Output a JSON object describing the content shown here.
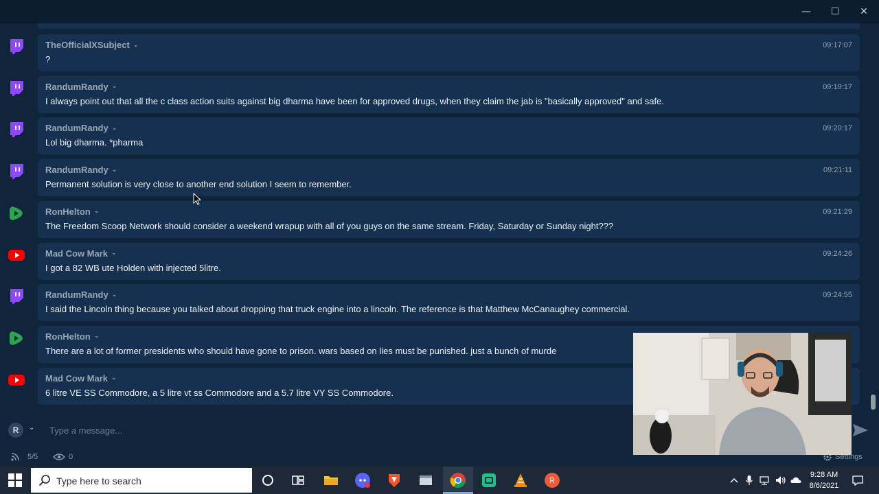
{
  "window": {
    "minimize_symbol": "—",
    "maximize_symbol": "☐",
    "close_symbol": "✕"
  },
  "messages": [
    {
      "platform": "twitch",
      "user": "TheOfficialXSubject",
      "time": "09:17:07",
      "text": "?"
    },
    {
      "platform": "twitch",
      "user": "RandumRandy",
      "time": "09:19:17",
      "text": "I always point out that all the c class action suits against big dharma have been for approved drugs, when they claim the jab is \"basically approved\" and safe."
    },
    {
      "platform": "twitch",
      "user": "RandumRandy",
      "time": "09:20:17",
      "text": "Lol big dharma. *pharma"
    },
    {
      "platform": "twitch",
      "user": "RandumRandy",
      "time": "09:21:11",
      "text": "Permanent solution is very close to another end solution I seem to remember."
    },
    {
      "platform": "rumble",
      "user": "RonHelton",
      "time": "09:21:29",
      "text": "The Freedom Scoop Network should consider a weekend wrapup with all of you guys on the same stream. Friday, Saturday or Sunday night???"
    },
    {
      "platform": "youtube",
      "user": "Mad Cow Mark",
      "time": "09:24:26",
      "text": "I got a 82 WB ute Holden with injected 5litre."
    },
    {
      "platform": "twitch",
      "user": "RandumRandy",
      "time": "09:24:55",
      "text": "I said the Lincoln thing because you talked about dropping that truck engine into a lincoln. The reference is that Matthew McCanaughey commercial."
    },
    {
      "platform": "rumble",
      "user": "RonHelton",
      "time": "",
      "text": "There are a lot of former presidents who should have gone to prison. wars based on lies must be punished. just a bunch of murde"
    },
    {
      "platform": "youtube",
      "user": "Mad Cow Mark",
      "time": "",
      "text": "6 litre VE SS Commodore, a 5 litre vt ss Commodore and a 5.7 litre VY SS Commodore."
    }
  ],
  "composer": {
    "avatar_letter": "R",
    "placeholder": "Type a message..."
  },
  "status": {
    "message_count": "5/5",
    "viewers": "0",
    "settings_label": "Settings"
  },
  "taskbar": {
    "search_placeholder": "Type here to search",
    "time": "9:28 AM",
    "date": "8/6/2021"
  },
  "colors": {
    "background": "#10243b",
    "card": "#16314f",
    "twitch": "#9146ff",
    "youtube": "#ff0000",
    "rumble": "#2da44e"
  }
}
